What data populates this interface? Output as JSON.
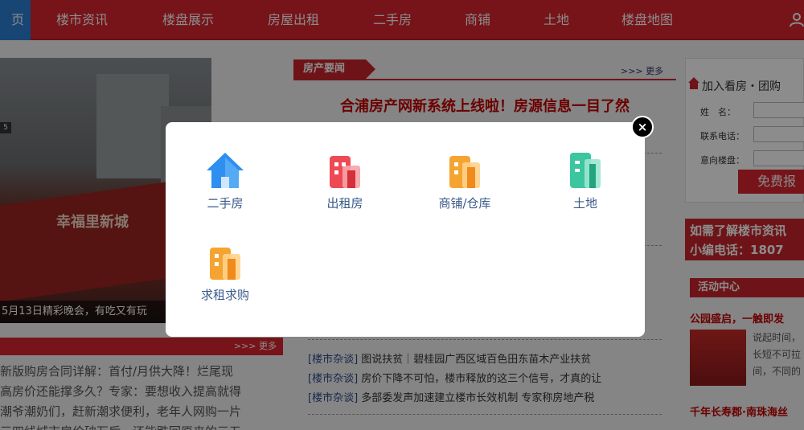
{
  "nav": {
    "home": "页",
    "items": [
      "楼市资讯",
      "楼盘展示",
      "房屋出租",
      "二手房",
      "商铺",
      "土地",
      "楼盘地图"
    ]
  },
  "slider": {
    "badge": "5",
    "banner_text": "幸福里新城",
    "caption": "5月13日精彩晚会，有吃又有玩"
  },
  "left_news": {
    "more": ">>> 更多",
    "lines": [
      "新版购房合同详解：首付/月供大降！烂尾现",
      "高房价还能撑多久？专家：要想收入提高就得",
      "潮爷潮奶们，赶新潮求便利，老年人网购一片",
      "三四线城市房价破万后，还能跌回原来的三五"
    ]
  },
  "middle": {
    "tab": "房产要闻",
    "more": ">>> 更多",
    "headline": "合浦房产网新系统上线啦！房源信息一目了然",
    "list": [
      {
        "tag": "[楼市杂谈]",
        "text": " 图说扶贫｜碧桂园广西区域百色田东苗木产业扶贫"
      },
      {
        "tag": "[楼市杂谈]",
        "text": " 房价下降不可怕，楼市释放的这三个信号，才真的让"
      },
      {
        "tag": "[楼市杂谈]",
        "text": " 多部委发声加速建立楼市长效机制 专家称房地产税"
      }
    ]
  },
  "right": {
    "title": "加入看房・团购",
    "labels": [
      "姓　名：",
      "联系电话：",
      "意向楼盘："
    ],
    "button": "免费报",
    "hotline": [
      "如需了解楼市资讯",
      "小编电话：1807"
    ],
    "activity_header": "活动中心",
    "activity_title": "公园盛启，一触即发",
    "activity_text": [
      "说起时间，",
      "长短不可拉",
      "间，不同的"
    ],
    "activity_title2": "千年长寿郡·南珠海丝"
  },
  "modal": {
    "options": [
      {
        "label": "二手房",
        "icon": "house-icon",
        "color": "#2e8ff0"
      },
      {
        "label": "出租房",
        "icon": "rent-building-icon",
        "color": "#ee4a55"
      },
      {
        "label": "商铺/仓库",
        "icon": "shop-building-icon",
        "color": "#f5a431"
      },
      {
        "label": "土地",
        "icon": "land-building-icon",
        "color": "#3cc6a0"
      },
      {
        "label": "求租求购",
        "icon": "request-building-icon",
        "color": "#f5a431"
      }
    ],
    "close": "×"
  }
}
